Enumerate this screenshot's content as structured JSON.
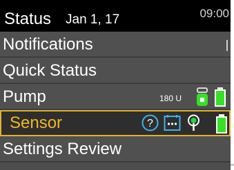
{
  "status_bar": {
    "title": "Status",
    "date": "Jan 1, 17",
    "time": "09:00"
  },
  "menu": {
    "items": [
      {
        "label": "Notifications"
      },
      {
        "label": "Quick Status"
      },
      {
        "label": "Pump",
        "reservoir_text": "180 U"
      },
      {
        "label": "Sensor",
        "selected": true
      },
      {
        "label": "Settings Review"
      }
    ]
  },
  "icons": {
    "reservoir": "reservoir-icon",
    "pump_battery": "battery-icon",
    "sensor_help": "question-mark-icon",
    "sensor_calibration": "calibration-dots-icon",
    "sensor_connection": "sensor-antenna-icon",
    "sensor_battery": "battery-icon"
  },
  "colors": {
    "status_bar": "#000000",
    "menu_background": "#505050",
    "selection_border": "#e2b22a",
    "selection_text": "#f2b61e",
    "battery_green": "#36e026",
    "icon_blue": "#3fb3e8",
    "antenna_green": "#2bd23a"
  },
  "indicators": {
    "pump_battery_level": 1.0,
    "sensor_battery_level": 1.0
  }
}
